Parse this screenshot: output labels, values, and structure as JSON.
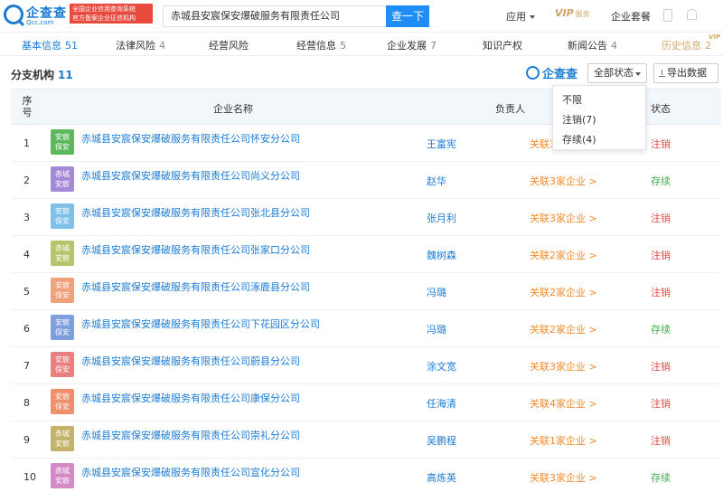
{
  "header": {
    "logo_text": "企查查",
    "logo_sub": "Qcc.com",
    "cert_line1": "全国企业信用查询系统",
    "cert_line2": "官方备案企业征信机构",
    "search_value": "赤城县安宸保安爆破服务有限责任公司",
    "search_button": "查一下",
    "nav_app": "应用",
    "nav_vip": "VIP",
    "nav_vip_sub": "服务",
    "nav_package": "企业套餐"
  },
  "tabs": [
    {
      "label": "基本信息",
      "count": "51"
    },
    {
      "label": "法律风险",
      "count": "4"
    },
    {
      "label": "经营风险",
      "count": ""
    },
    {
      "label": "经营信息",
      "count": "5"
    },
    {
      "label": "企业发展",
      "count": "7"
    },
    {
      "label": "知识产权",
      "count": ""
    },
    {
      "label": "新闻公告",
      "count": "4"
    },
    {
      "label": "历史信息",
      "count": "2"
    }
  ],
  "tab_vip_mark": "VIP",
  "section": {
    "title": "分支机构",
    "count": "11",
    "logo_text": "企查查",
    "status_button": "全部状态",
    "export_button": "导出数据"
  },
  "dropdown": {
    "options": [
      "不限",
      "注销(7)",
      "存续(4)"
    ]
  },
  "table": {
    "headers": {
      "idx": "序号",
      "name": "企业名称",
      "person": "负责人",
      "status": "状态"
    },
    "rows": [
      {
        "idx": "1",
        "avatar": [
          "安宸",
          "保安"
        ],
        "avatar_color": "#5cb85c",
        "name": "赤城县安宸保安爆破服务有限责任公司怀安分公司",
        "person": "王富宪",
        "assoc": "关联3家企业 >",
        "status": "注销",
        "status_color": "#e84a3e"
      },
      {
        "idx": "2",
        "avatar": [
          "赤城",
          "安宸"
        ],
        "avatar_color": "#a48ad6",
        "name": "赤城县安宸保安爆破服务有限责任公司尚义分公司",
        "person": "赵华",
        "assoc": "关联3家企业 >",
        "status": "存续",
        "status_color": "#3cae4a"
      },
      {
        "idx": "3",
        "avatar": [
          "安宸",
          "保安"
        ],
        "avatar_color": "#7ec0e8",
        "name": "赤城县安宸保安爆破服务有限责任公司张北县分公司",
        "person": "张月利",
        "assoc": "关联3家企业 >",
        "status": "注销",
        "status_color": "#e84a3e"
      },
      {
        "idx": "4",
        "avatar": [
          "赤城",
          "安宸"
        ],
        "avatar_color": "#b8c46a",
        "name": "赤城县安宸保安爆破服务有限责任公司张家口分公司",
        "person": "魏树森",
        "assoc": "关联2家企业 >",
        "status": "注销",
        "status_color": "#e84a3e"
      },
      {
        "idx": "5",
        "avatar": [
          "安宸",
          "保安"
        ],
        "avatar_color": "#f0a07a",
        "name": "赤城县安宸保安爆破服务有限责任公司涿鹿县分公司",
        "person": "冯璐",
        "assoc": "关联2家企业 >",
        "status": "注销",
        "status_color": "#e84a3e"
      },
      {
        "idx": "6",
        "avatar": [
          "安宸",
          "保安"
        ],
        "avatar_color": "#7e9ee0",
        "name": "赤城县安宸保安爆破服务有限责任公司下花园区分公司",
        "person": "冯璐",
        "assoc": "关联2家企业 >",
        "status": "存续",
        "status_color": "#3cae4a"
      },
      {
        "idx": "7",
        "avatar": [
          "安宸",
          "保安"
        ],
        "avatar_color": "#e97f7f",
        "name": "赤城县安宸保安爆破服务有限责任公司蔚县分公司",
        "person": "涂文宽",
        "assoc": "关联3家企业 >",
        "status": "注销",
        "status_color": "#e84a3e"
      },
      {
        "idx": "8",
        "avatar": [
          "安宸",
          "保安"
        ],
        "avatar_color": "#f08f6c",
        "name": "赤城县安宸保安爆破服务有限责任公司康保分公司",
        "person": "任海清",
        "assoc": "关联4家企业 >",
        "status": "注销",
        "status_color": "#e84a3e"
      },
      {
        "idx": "9",
        "avatar": [
          "赤城",
          "安宸"
        ],
        "avatar_color": "#c3b36a",
        "name": "赤城县安宸保安爆破服务有限责任公司崇礼分公司",
        "person": "吴鹏程",
        "assoc": "关联1家企业 >",
        "status": "注销",
        "status_color": "#e84a3e"
      },
      {
        "idx": "10",
        "avatar": [
          "赤城",
          "安宸"
        ],
        "avatar_color": "#d38ac7",
        "name": "赤城县安宸保安爆破服务有限责任公司宣化分公司",
        "person": "高炼英",
        "assoc": "关联3家企业 >",
        "status": "存续",
        "status_color": "#3cae4a"
      }
    ]
  }
}
